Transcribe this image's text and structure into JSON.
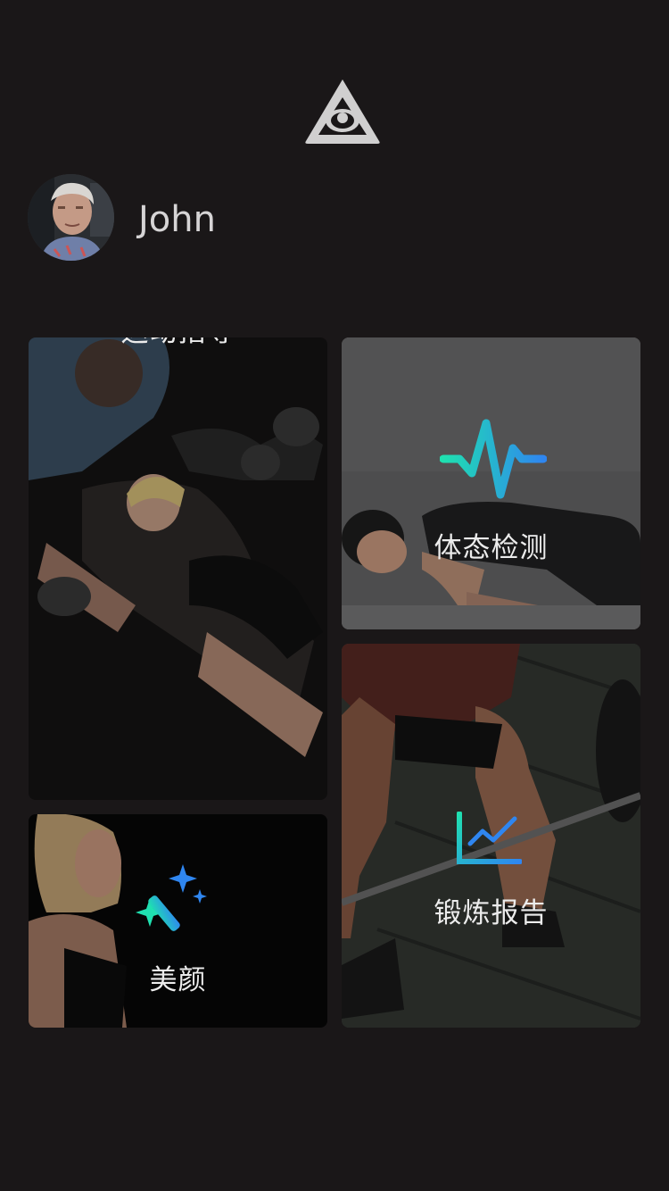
{
  "app": {
    "logo_icon": "eye-triangle-logo-icon"
  },
  "user": {
    "name": "John",
    "avatar_icon": "user-avatar"
  },
  "cards": {
    "sport": {
      "label": "运动指导",
      "icon": "running-person-icon",
      "accent": "#2ec4c7"
    },
    "body": {
      "label": "体态检测",
      "icon": "heartbeat-pulse-icon",
      "accent": "#1fd1b8"
    },
    "beauty": {
      "label": "美颜",
      "icon": "magic-wand-sparkle-icon",
      "accent": "#2bb4d9"
    },
    "report": {
      "label": "锻炼报告",
      "icon": "line-chart-icon",
      "accent": "#22c7c2"
    }
  },
  "colors": {
    "background": "#1a1718",
    "text": "#ececec",
    "accent_gradient_start": "#1fe0b0",
    "accent_gradient_end": "#2f86f0"
  }
}
